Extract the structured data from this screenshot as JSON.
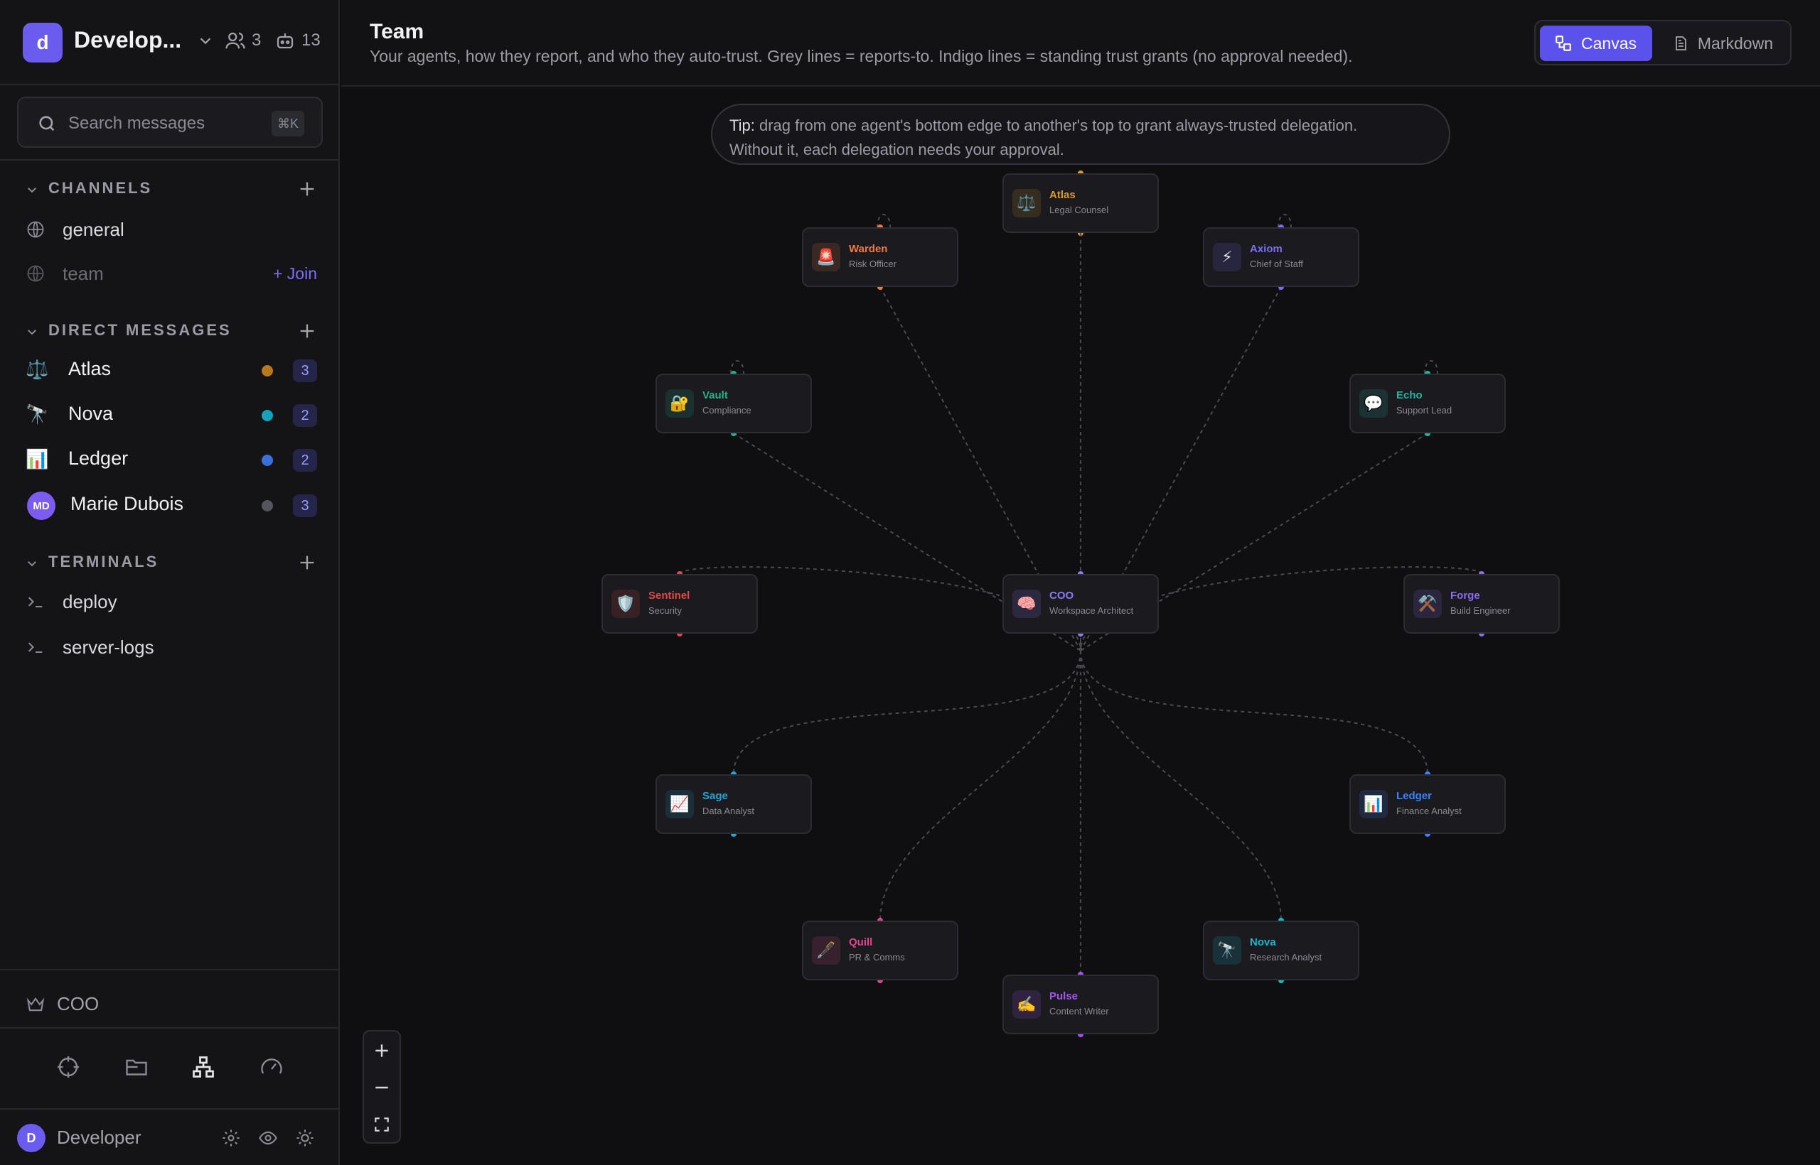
{
  "workspace": {
    "initial": "d",
    "name": "Develop...",
    "members_count": "3",
    "agents_count": "13"
  },
  "search": {
    "placeholder": "Search messages",
    "shortcut": "⌘K"
  },
  "channels": {
    "header": "CHANNELS",
    "items": [
      {
        "name": "general",
        "joined": true
      },
      {
        "name": "team",
        "joined": false,
        "join_label": "+ Join"
      }
    ]
  },
  "direct_messages": {
    "header": "DIRECT MESSAGES",
    "items": [
      {
        "icon": "⚖️",
        "name": "Atlas",
        "status_color": "#b7791f",
        "count": "3"
      },
      {
        "icon": "🔭",
        "name": "Nova",
        "status_color": "#14a3b8",
        "count": "2"
      },
      {
        "icon": "📊",
        "name": "Ledger",
        "status_color": "#3b6fd8",
        "count": "2"
      },
      {
        "avatar": "MD",
        "name": "Marie Dubois",
        "status_color": "#55555e",
        "count": "3"
      }
    ]
  },
  "terminals": {
    "header": "TERMINALS",
    "items": [
      {
        "name": "deploy"
      },
      {
        "name": "server-logs"
      }
    ]
  },
  "coo_label": "COO",
  "user": {
    "initial": "D",
    "name": "Developer"
  },
  "page": {
    "title": "Team",
    "subtitle": "Your agents, how they report, and who they auto-trust. Grey lines = reports-to. Indigo lines = standing trust grants (no approval needed).",
    "view_toggle": {
      "canvas": "Canvas",
      "markdown": "Markdown",
      "active": "canvas"
    }
  },
  "tip": {
    "label": "Tip:",
    "line1": " drag from one agent's bottom edge to another's top to grant always-trusted delegation.",
    "line2": "Without it, each delegation needs your approval."
  },
  "colors": {
    "accent": "#5b52ec",
    "edge": "#4a4a52"
  },
  "org_chart": {
    "root": "coo",
    "agents": [
      {
        "id": "coo",
        "name": "COO",
        "role": "Workspace Architect",
        "icon": "🧠",
        "color": "#8b7cf6"
      },
      {
        "id": "atlas",
        "name": "Atlas",
        "role": "Legal Counsel",
        "icon": "⚖️",
        "color": "#d89b2b"
      },
      {
        "id": "warden",
        "name": "Warden",
        "role": "Risk Officer",
        "icon": "🚨",
        "color": "#f07b3f"
      },
      {
        "id": "axiom",
        "name": "Axiom",
        "role": "Chief of Staff",
        "icon": "⚡",
        "color": "#7c6df7"
      },
      {
        "id": "vault",
        "name": "Vault",
        "role": "Compliance",
        "icon": "🔐",
        "color": "#22b38a"
      },
      {
        "id": "echo",
        "name": "Echo",
        "role": "Support Lead",
        "icon": "💬",
        "color": "#22b3a3"
      },
      {
        "id": "sentinel",
        "name": "Sentinel",
        "role": "Security",
        "icon": "🛡️",
        "color": "#e04848"
      },
      {
        "id": "forge",
        "name": "Forge",
        "role": "Build Engineer",
        "icon": "⚒️",
        "color": "#8b6cf0"
      },
      {
        "id": "sage",
        "name": "Sage",
        "role": "Data Analyst",
        "icon": "📈",
        "color": "#1ea7d8"
      },
      {
        "id": "ledger",
        "name": "Ledger",
        "role": "Finance Analyst",
        "icon": "📊",
        "color": "#3b82f6"
      },
      {
        "id": "quill",
        "name": "Quill",
        "role": "PR & Comms",
        "icon": "🖋️",
        "color": "#e0488c"
      },
      {
        "id": "nova",
        "name": "Nova",
        "role": "Research Analyst",
        "icon": "🔭",
        "color": "#14b8c8"
      },
      {
        "id": "pulse",
        "name": "Pulse",
        "role": "Content Writer",
        "icon": "✍️",
        "color": "#a855f7"
      }
    ]
  }
}
